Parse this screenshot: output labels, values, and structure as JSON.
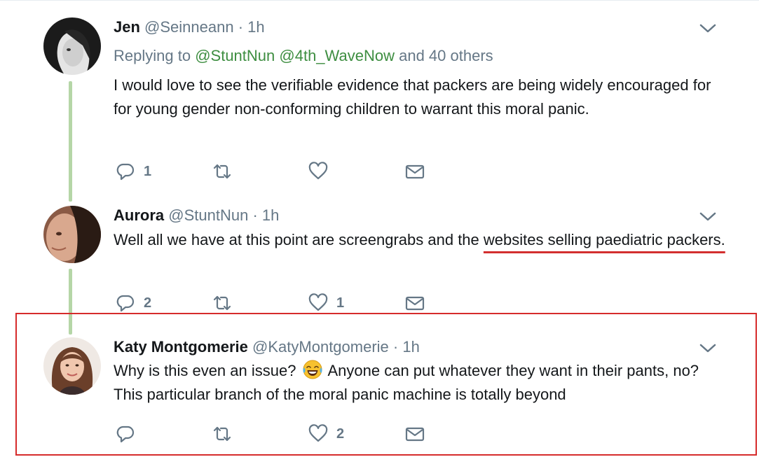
{
  "tweets": [
    {
      "name": "Jen",
      "handle": "@Seinneann",
      "sep": "·",
      "time": "1h",
      "reply_prefix": "Replying to",
      "reply_mentions": [
        "@StuntNun",
        "@4th_WaveNow"
      ],
      "reply_suffix": "and 40 others",
      "text": "I would love to see the verifiable evidence that packers are being widely encouraged for for young gender non-conforming children to warrant this moral panic.",
      "reply_count": "1",
      "retweet_count": "",
      "like_count": ""
    },
    {
      "name": "Aurora",
      "handle": "@StuntNun",
      "sep": "·",
      "time": "1h",
      "text_plain": "Well all we have at this point are screengrabs and the ",
      "text_underlined": "websites selling paediatric packers.",
      "reply_count": "2",
      "retweet_count": "",
      "like_count": "1"
    },
    {
      "name": "Katy Montgomerie",
      "handle": "@KatyMontgomerie",
      "sep": "·",
      "time": "1h",
      "text_before_emoji": "Why is this even an issue? ",
      "emoji": "face-with-tears-of-joy",
      "text_after_emoji": " Anyone can put whatever they want in their pants, no? This particular branch of the moral panic machine is totally beyond",
      "reply_count": "",
      "retweet_count": "",
      "like_count": "2"
    }
  ],
  "colors": {
    "thread_line": "#b5d6a7",
    "mention": "#3e8e41",
    "highlight": "#d62b2b",
    "underline": "#d32f2f",
    "muted": "#657786"
  },
  "icons": [
    "reply-icon",
    "retweet-icon",
    "like-icon",
    "dm-icon",
    "chevron-down-icon"
  ]
}
